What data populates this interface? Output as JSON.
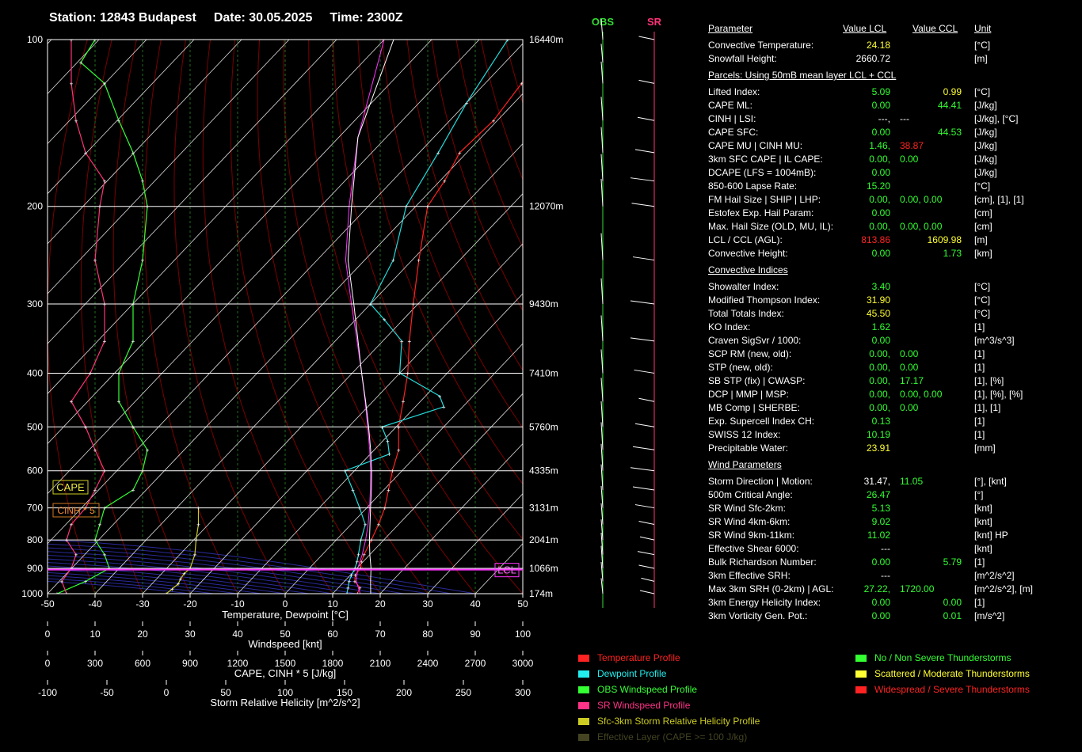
{
  "header": {
    "station": "Station: 12843 Budapest",
    "date": "Date: 30.05.2025",
    "time": "Time: 2300Z"
  },
  "wind_columns": {
    "obs": "OBS",
    "sr": "SR"
  },
  "chart_data": {
    "type": "line",
    "title": "",
    "xlabel": "Temperature, Dewpoint  [°C]",
    "ylabel": "",
    "xlim": [
      -50,
      50
    ],
    "ylim": [
      1000,
      100
    ],
    "x_ticks": [
      "-50",
      "-40",
      "-30",
      "-20",
      "-10",
      "0",
      "10",
      "20",
      "30",
      "40",
      "50"
    ],
    "pressure_ticks": [
      "100",
      "200",
      "300",
      "400",
      "500",
      "600",
      "700",
      "800",
      "900",
      "1000"
    ],
    "height_labels": [
      {
        "p": 100,
        "label": "16440m"
      },
      {
        "p": 200,
        "label": "12070m"
      },
      {
        "p": 300,
        "label": "9430m"
      },
      {
        "p": 400,
        "label": "7410m"
      },
      {
        "p": 500,
        "label": "5760m"
      },
      {
        "p": 600,
        "label": "4335m"
      },
      {
        "p": 700,
        "label": "3131m"
      },
      {
        "p": 800,
        "label": "2041m"
      },
      {
        "p": 900,
        "label": "1066m"
      },
      {
        "p": 1000,
        "label": "174m"
      }
    ],
    "axes2": [
      {
        "label": "Windspeed  [knt]",
        "ticks": [
          "0",
          "10",
          "20",
          "30",
          "40",
          "50",
          "60",
          "70",
          "80",
          "90",
          "100"
        ]
      },
      {
        "label": "CAPE, CINH * 5  [J/kg]",
        "ticks": [
          "0",
          "300",
          "600",
          "900",
          "1200",
          "1500",
          "1800",
          "2100",
          "2400",
          "2700",
          "3000"
        ]
      },
      {
        "label": "Storm Relative Helicity  [m^2/s^2]",
        "ticks": [
          "-100",
          "-50",
          "0",
          "50",
          "100",
          "150",
          "200",
          "250",
          "300"
        ]
      }
    ],
    "labels": {
      "cape": "CAPE",
      "cinh": "CINH * 5",
      "lcl": "LCL"
    },
    "lcl_p": 905,
    "series": [
      {
        "name": "Temperature Profile",
        "color": "#ff2222",
        "points": [
          [
            1000,
            15.2
          ],
          [
            975,
            14.5
          ],
          [
            950,
            12.2
          ],
          [
            925,
            11.0
          ],
          [
            900,
            10.8
          ],
          [
            875,
            9.6
          ],
          [
            850,
            8.8
          ],
          [
            800,
            7.4
          ],
          [
            750,
            5.8
          ],
          [
            700,
            3.8
          ],
          [
            650,
            1.0
          ],
          [
            600,
            -2.0
          ],
          [
            550,
            -4.9
          ],
          [
            500,
            -9.5
          ],
          [
            450,
            -13.6
          ],
          [
            400,
            -18.3
          ],
          [
            350,
            -24.4
          ],
          [
            300,
            -31.0
          ],
          [
            250,
            -38.6
          ],
          [
            200,
            -47.5
          ],
          [
            180,
            -49.0
          ],
          [
            160,
            -51.5
          ],
          [
            140,
            -50.8
          ],
          [
            120,
            -52.3
          ],
          [
            100,
            -55.2
          ]
        ]
      },
      {
        "name": "Dewpoint Profile",
        "color": "#22dddd",
        "points": [
          [
            1000,
            13.0
          ],
          [
            975,
            12.0
          ],
          [
            950,
            11.0
          ],
          [
            925,
            10.2
          ],
          [
            900,
            9.6
          ],
          [
            875,
            8.7
          ],
          [
            850,
            7.6
          ],
          [
            800,
            5.2
          ],
          [
            750,
            3.0
          ],
          [
            700,
            -1.5
          ],
          [
            650,
            -6.5
          ],
          [
            600,
            -12.0
          ],
          [
            560,
            -6.0
          ],
          [
            530,
            -9.0
          ],
          [
            500,
            -13.0
          ],
          [
            460,
            -4.0
          ],
          [
            440,
            -7.0
          ],
          [
            400,
            -20.0
          ],
          [
            350,
            -26.0
          ],
          [
            320,
            -34.0
          ],
          [
            300,
            -40.0
          ],
          [
            250,
            -44.0
          ],
          [
            200,
            -52.0
          ],
          [
            160,
            -56.0
          ],
          [
            130,
            -60.0
          ],
          [
            100,
            -64.0
          ]
        ]
      },
      {
        "name": "Parcel",
        "color": "#ff33ff",
        "points": [
          [
            1000,
            15.8
          ],
          [
            950,
            12.5
          ],
          [
            900,
            10.2
          ],
          [
            850,
            8.4
          ],
          [
            800,
            6.2
          ],
          [
            750,
            3.6
          ],
          [
            700,
            0.6
          ],
          [
            650,
            -2.8
          ],
          [
            600,
            -6.6
          ],
          [
            550,
            -11.0
          ],
          [
            500,
            -16.0
          ],
          [
            450,
            -21.6
          ],
          [
            400,
            -28.0
          ],
          [
            350,
            -35.4
          ],
          [
            300,
            -44.0
          ],
          [
            250,
            -54.0
          ],
          [
            200,
            -64.0
          ],
          [
            150,
            -76.0
          ],
          [
            100,
            -90.0
          ]
        ]
      },
      {
        "name": "Virtual Parcel",
        "color": "#ffffff",
        "points": [
          [
            1000,
            18.0
          ],
          [
            950,
            15.5
          ],
          [
            900,
            13.0
          ],
          [
            850,
            10.0
          ],
          [
            800,
            7.0
          ],
          [
            750,
            4.0
          ],
          [
            700,
            0.8
          ],
          [
            650,
            -2.6
          ],
          [
            600,
            -6.4
          ],
          [
            550,
            -10.8
          ],
          [
            500,
            -15.8
          ],
          [
            450,
            -21.5
          ],
          [
            400,
            -28.0
          ],
          [
            350,
            -35.2
          ],
          [
            300,
            -43.5
          ],
          [
            250,
            -53.5
          ],
          [
            200,
            -63.5
          ],
          [
            150,
            -76.0
          ],
          [
            100,
            -88.0
          ]
        ]
      }
    ],
    "obs_wind": {
      "name": "OBS Windspeed Profile",
      "color": "#33ff33",
      "points": [
        [
          1000,
          2
        ],
        [
          950,
          8
        ],
        [
          900,
          13
        ],
        [
          850,
          12
        ],
        [
          800,
          10
        ],
        [
          750,
          11
        ],
        [
          700,
          12
        ],
        [
          650,
          18
        ],
        [
          600,
          20
        ],
        [
          550,
          21
        ],
        [
          500,
          18
        ],
        [
          450,
          15
        ],
        [
          400,
          15
        ],
        [
          350,
          18
        ],
        [
          300,
          18
        ],
        [
          250,
          20
        ],
        [
          200,
          21
        ],
        [
          180,
          20
        ],
        [
          160,
          18
        ],
        [
          140,
          15
        ],
        [
          120,
          12
        ],
        [
          110,
          7
        ],
        [
          100,
          10
        ]
      ]
    },
    "sr_wind": {
      "name": "SR Windspeed Profile",
      "color": "#ff3377",
      "points": [
        [
          1000,
          4
        ],
        [
          950,
          3
        ],
        [
          900,
          5
        ],
        [
          850,
          6
        ],
        [
          800,
          4
        ],
        [
          750,
          5
        ],
        [
          700,
          8
        ],
        [
          650,
          10
        ],
        [
          600,
          12
        ],
        [
          550,
          10
        ],
        [
          500,
          8
        ],
        [
          450,
          5
        ],
        [
          400,
          9
        ],
        [
          350,
          12
        ],
        [
          300,
          12
        ],
        [
          250,
          10
        ],
        [
          200,
          11
        ],
        [
          180,
          12
        ],
        [
          160,
          8
        ],
        [
          140,
          6
        ],
        [
          120,
          5
        ],
        [
          100,
          5
        ]
      ]
    },
    "helicity": {
      "name": "Sfc-3km Storm Relative Helicity Profile",
      "color": "#cccc22",
      "points": [
        [
          1000,
          0
        ],
        [
          980,
          5
        ],
        [
          960,
          10
        ],
        [
          940,
          12
        ],
        [
          920,
          15
        ],
        [
          900,
          20
        ],
        [
          850,
          24
        ],
        [
          800,
          25
        ],
        [
          750,
          27
        ],
        [
          700,
          27
        ]
      ]
    }
  },
  "params": {
    "header": {
      "parameter": "Parameter",
      "lcl": "Value LCL",
      "ccl": "Value CCL",
      "unit": "Unit"
    },
    "rows": [
      {
        "name": "Convective Temperature:",
        "v1": "24.18",
        "v1c": "y",
        "v2": "",
        "v2c": "",
        "unit": "[°C]"
      },
      {
        "name": "Snowfall Height:",
        "v1": "2660.72",
        "v1c": "w",
        "v2": "",
        "v2c": "",
        "unit": "[m]"
      },
      {
        "section": "Parcels: Using 50mB mean layer LCL + CCL"
      },
      {
        "name": "Lifted Index:",
        "v1": "5.09",
        "v1c": "g",
        "v2": "0.99",
        "v2c": "y",
        "unit": "[°C]"
      },
      {
        "name": "CAPE ML:",
        "v1": "0.00",
        "v1c": "g",
        "v2": "44.41",
        "v2c": "g",
        "unit": "[J/kg]"
      },
      {
        "name": "CINH | LSI:",
        "v1": "---,",
        "v1c": "w",
        "v2": "---",
        "v2c": "w",
        "unit": "[J/kg], [°C]",
        "v2left": true
      },
      {
        "name": "CAPE SFC:",
        "v1": "0.00",
        "v1c": "g",
        "v2": "44.53",
        "v2c": "g",
        "unit": "[J/kg]"
      },
      {
        "name": "CAPE MU | CINH MU:",
        "v1": "1.46,",
        "v1c": "g",
        "v2": "38.87",
        "v2c": "r",
        "unit": "[J/kg]",
        "v2left": true
      },
      {
        "name": "3km SFC CAPE | IL CAPE:",
        "v1": "0.00,",
        "v1c": "g",
        "v2": "0.00",
        "v2c": "g",
        "unit": "[J/kg]",
        "v2left": true
      },
      {
        "name": "DCAPE (LFS = 1004mB):",
        "v1": "0.00",
        "v1c": "g",
        "v2": "",
        "v2c": "",
        "unit": "[J/kg]"
      },
      {
        "name": "850-600 Lapse Rate:",
        "v1": "15.20",
        "v1c": "g",
        "v2": "",
        "v2c": "",
        "unit": "[°C]"
      },
      {
        "name": "FM Hail Size | SHIP | LHP:",
        "v1": "0.00,",
        "v1c": "g",
        "v2": "0.00,  0.00",
        "v2c": "g",
        "unit": "[cm], [1], [1]",
        "v2left": true
      },
      {
        "name": "Estofex Exp. Hail Param:",
        "v1": "0.00",
        "v1c": "g",
        "v2": "",
        "v2c": "",
        "unit": "[cm]"
      },
      {
        "name": "Max. Hail Size (OLD, MU, IL):",
        "v1": "0.00,",
        "v1c": "g",
        "v2": "0.00,  0.00",
        "v2c": "g",
        "unit": "[cm]",
        "v2left": true
      },
      {
        "name": "LCL / CCL (AGL):",
        "v1": "813.86",
        "v1c": "r",
        "v2": "1609.98",
        "v2c": "y",
        "unit": "[m]"
      },
      {
        "name": "Convective Height:",
        "v1": "0.00",
        "v1c": "g",
        "v2": "1.73",
        "v2c": "g",
        "unit": "[km]"
      },
      {
        "section": "Convective Indices"
      },
      {
        "name": "Showalter Index:",
        "v1": "3.40",
        "v1c": "g",
        "v2": "",
        "v2c": "",
        "unit": "[°C]"
      },
      {
        "name": "Modified Thompson Index:",
        "v1": "31.90",
        "v1c": "y",
        "v2": "",
        "v2c": "",
        "unit": "[°C]"
      },
      {
        "name": "Total Totals Index:",
        "v1": "45.50",
        "v1c": "y",
        "v2": "",
        "v2c": "",
        "unit": "[°C]"
      },
      {
        "name": "KO Index:",
        "v1": "1.62",
        "v1c": "g",
        "v2": "",
        "v2c": "",
        "unit": "[1]"
      },
      {
        "name": "Craven SigSvr / 1000:",
        "v1": "0.00",
        "v1c": "g",
        "v2": "",
        "v2c": "",
        "unit": "[m^3/s^3]"
      },
      {
        "name": "SCP RM (new, old):",
        "v1": "0.00,",
        "v1c": "g",
        "v2": "0.00",
        "v2c": "g",
        "unit": "[1]",
        "v2left": true
      },
      {
        "name": "STP (new, old):",
        "v1": "0.00,",
        "v1c": "g",
        "v2": "0.00",
        "v2c": "g",
        "unit": "[1]",
        "v2left": true
      },
      {
        "name": "SB STP (fix) | CWASP:",
        "v1": "0.00,",
        "v1c": "g",
        "v2": "17.17",
        "v2c": "g",
        "unit": "[1], [%]",
        "v2left": true
      },
      {
        "name": "DCP | MMP | MSP:",
        "v1": "0.00,",
        "v1c": "g",
        "v2": "0.00,  0.00",
        "v2c": "g",
        "unit": "[1], [%], [%]",
        "v2left": true
      },
      {
        "name": "MB Comp | SHERBE:",
        "v1": "0.00,",
        "v1c": "g",
        "v2": "0.00",
        "v2c": "g",
        "unit": "[1], [1]",
        "v2left": true
      },
      {
        "name": "Exp. Supercell Index CH:",
        "v1": "0.13",
        "v1c": "g",
        "v2": "",
        "v2c": "",
        "unit": "[1]"
      },
      {
        "name": "SWISS 12 Index:",
        "v1": "10.19",
        "v1c": "g",
        "v2": "",
        "v2c": "",
        "unit": "[1]"
      },
      {
        "name": "Precipitable Water:",
        "v1": "23.91",
        "v1c": "y",
        "v2": "",
        "v2c": "",
        "unit": "[mm]"
      },
      {
        "section": "Wind Parameters"
      },
      {
        "name": "Storm Direction | Motion:",
        "v1": "31.47,",
        "v1c": "w",
        "v2": "11.05",
        "v2c": "g",
        "unit": "[°], [knt]",
        "v2left": true
      },
      {
        "name": "500m Critical Angle:",
        "v1": "26.47",
        "v1c": "g",
        "v2": "",
        "v2c": "",
        "unit": "[°]"
      },
      {
        "name": "SR Wind Sfc-2km:",
        "v1": "5.13",
        "v1c": "g",
        "v2": "",
        "v2c": "",
        "unit": "[knt]"
      },
      {
        "name": "SR Wind 4km-6km:",
        "v1": "9.02",
        "v1c": "g",
        "v2": "",
        "v2c": "",
        "unit": "[knt]"
      },
      {
        "name": "SR Wind 9km-11km:",
        "v1": "11.02",
        "v1c": "g",
        "v2": "",
        "v2c": "",
        "unit": "[knt] HP"
      },
      {
        "name": "Effective Shear 6000:",
        "v1": "---",
        "v1c": "w",
        "v2": "",
        "v2c": "",
        "unit": "[knt]"
      },
      {
        "name": "Bulk Richardson Number:",
        "v1": "0.00",
        "v1c": "g",
        "v2": "5.79",
        "v2c": "g",
        "unit": "[1]"
      },
      {
        "name": "3km Effective SRH:",
        "v1": "---",
        "v1c": "w",
        "v2": "",
        "v2c": "",
        "unit": "[m^2/s^2]"
      },
      {
        "name": "Max 3km SRH (0-2km) | AGL:",
        "v1": "27.22,",
        "v1c": "g",
        "v2": "1720.00",
        "v2c": "g",
        "unit": "[m^2/s^2], [m]",
        "v2left": true
      },
      {
        "name": "3km Energy Helicity Index:",
        "v1": "0.00",
        "v1c": "g",
        "v2": "0.00",
        "v2c": "g",
        "unit": "[1]"
      },
      {
        "name": "3km Vorticity Gen. Pot.:",
        "v1": "0.00",
        "v1c": "g",
        "v2": "0.01",
        "v2c": "g",
        "unit": "[m/s^2]"
      }
    ]
  },
  "legend_left": [
    {
      "label": "Temperature Profile",
      "color": "#ff2222"
    },
    {
      "label": "Dewpoint Profile",
      "color": "#22eeee"
    },
    {
      "label": "OBS Windspeed Profile",
      "color": "#33ff33"
    },
    {
      "label": "SR Windspeed Profile",
      "color": "#ff3388"
    },
    {
      "label": "Sfc-3km Storm Relative Helicity Profile",
      "color": "#cccc22"
    },
    {
      "label": "Effective Layer (CAPE >= 100 J/kg)",
      "color": "#444422"
    }
  ],
  "legend_right": [
    {
      "label": "No / Non Severe Thunderstorms",
      "color": "#33ff33"
    },
    {
      "label": "Scattered / Moderate Thunderstorms",
      "color": "#ffff33"
    },
    {
      "label": "Widespread / Severe Thunderstorms",
      "color": "#ff2222"
    }
  ]
}
